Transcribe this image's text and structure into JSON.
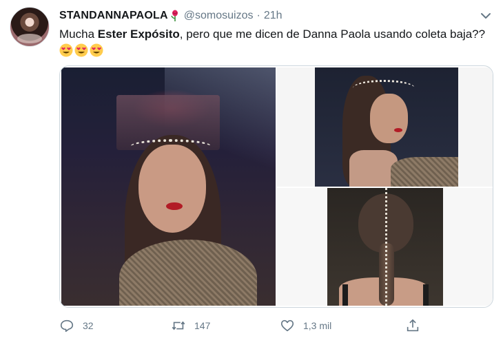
{
  "tweet": {
    "display_name": "STANDANNAPAOLA",
    "handle": "@somosuizos",
    "separator": "·",
    "time": "21h",
    "text_before": "Mucha ",
    "text_bold": "Ester Expósito",
    "text_after": ", pero que me dicen de Danna Paola usando coleta baja??",
    "emoji_name": "heart-eyes-emoji",
    "emoji_count": 3
  },
  "actions": {
    "reply_count": "32",
    "retweet_count": "147",
    "like_count": "1,3 mil"
  },
  "colors": {
    "secondary_text": "#657786",
    "border": "#ccd6dd",
    "primary_text": "#14171a"
  }
}
